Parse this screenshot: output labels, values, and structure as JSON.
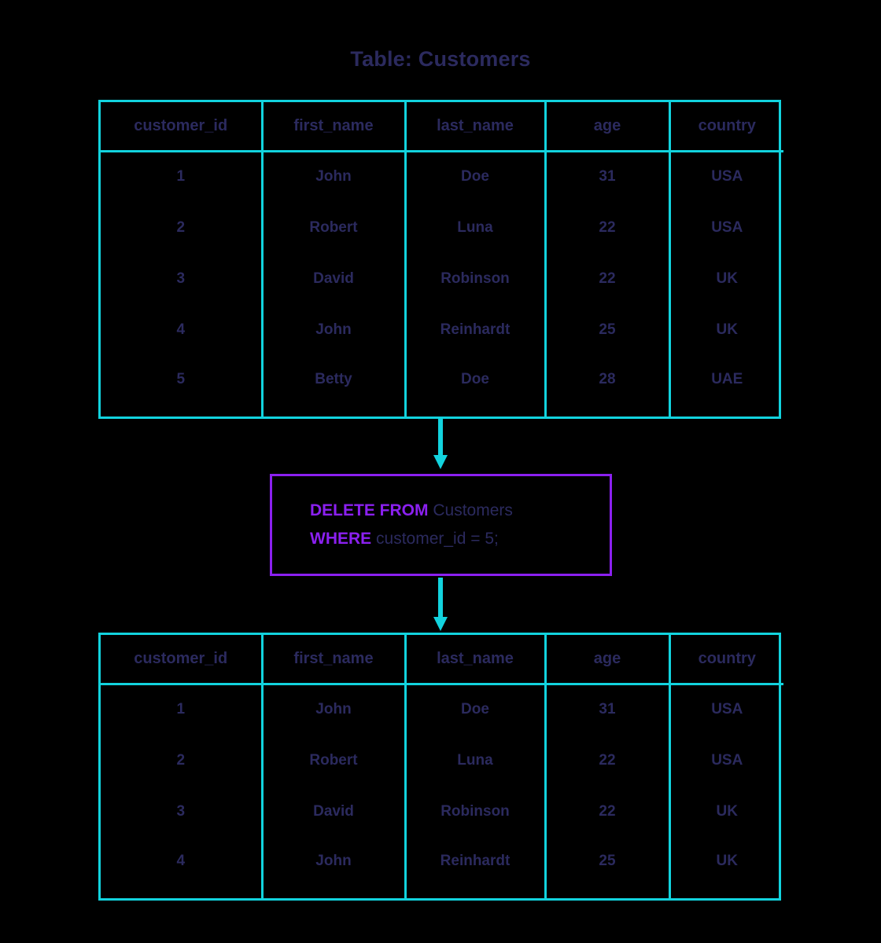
{
  "title": "Table: Customers",
  "colors": {
    "table_border": "#12d3de",
    "arrow": "#12d3de",
    "text": "#2b2a5e",
    "query_border": "#8b20f0",
    "keyword": "#8b20f0",
    "background": "#000000"
  },
  "table_before": {
    "name": "Customers",
    "columns": [
      "customer_id",
      "first_name",
      "last_name",
      "age",
      "country"
    ],
    "rows": [
      [
        "1",
        "John",
        "Doe",
        "31",
        "USA"
      ],
      [
        "2",
        "Robert",
        "Luna",
        "22",
        "USA"
      ],
      [
        "3",
        "David",
        "Robinson",
        "22",
        "UK"
      ],
      [
        "4",
        "John",
        "Reinhardt",
        "25",
        "UK"
      ],
      [
        "5",
        "Betty",
        "Doe",
        "28",
        "UAE"
      ]
    ]
  },
  "query": {
    "line1": {
      "keyword": "DELETE FROM",
      "rest": "Customers"
    },
    "line2": {
      "keyword": "WHERE",
      "rest": "customer_id = 5;"
    },
    "full_text": "DELETE FROM Customers WHERE customer_id = 5;"
  },
  "table_after": {
    "name": "Customers",
    "columns": [
      "customer_id",
      "first_name",
      "last_name",
      "age",
      "country"
    ],
    "rows": [
      [
        "1",
        "John",
        "Doe",
        "31",
        "USA"
      ],
      [
        "2",
        "Robert",
        "Luna",
        "22",
        "USA"
      ],
      [
        "3",
        "David",
        "Robinson",
        "22",
        "UK"
      ],
      [
        "4",
        "John",
        "Reinhardt",
        "25",
        "UK"
      ]
    ]
  }
}
